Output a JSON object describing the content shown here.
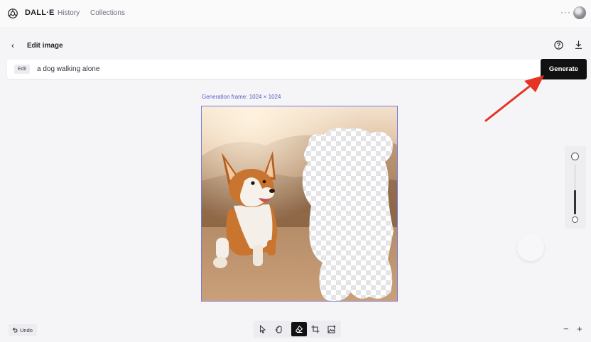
{
  "nav": {
    "brand": "DALL·E",
    "history": "History",
    "collections": "Collections",
    "more": "···"
  },
  "editor": {
    "title": "Edit image",
    "back_icon": "‹"
  },
  "prompt": {
    "badge": "Edit",
    "value": "a dog walking alone",
    "generate_label": "Generate"
  },
  "frame": {
    "label": "Generation frame: 1024 × 1024"
  },
  "toolbar": {
    "undo_label": "Undo",
    "tools": [
      "select-tool-icon",
      "pan-tool-icon",
      "eraser-tool-icon",
      "crop-tool-icon",
      "add-image-icon"
    ],
    "active_tool": "eraser-tool-icon"
  },
  "zoom": {
    "minus": "−",
    "plus": "+"
  },
  "colors": {
    "accent": "#5b5bc8",
    "generate_bg": "#111111",
    "arrow": "#e53424"
  }
}
